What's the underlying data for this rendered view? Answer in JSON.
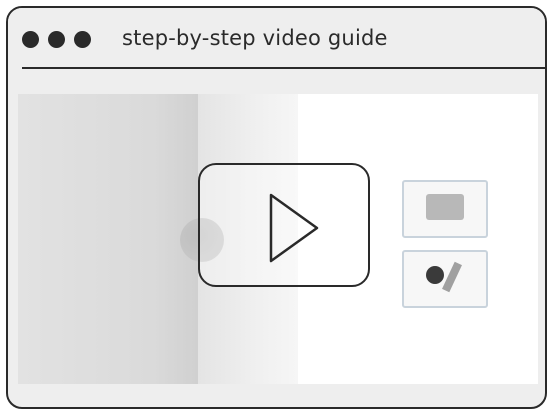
{
  "window": {
    "title": "step-by-step video guide",
    "controls": [
      "dot-1",
      "dot-2",
      "dot-3"
    ]
  },
  "video": {
    "play_icon": "play-icon"
  },
  "colors": {
    "frame": "#2a2a2a",
    "window_bg": "#eeeeee",
    "video_bg": "#ffffff"
  }
}
